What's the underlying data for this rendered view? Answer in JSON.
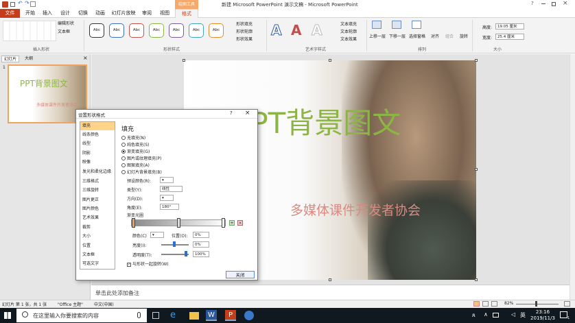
{
  "title_bar": {
    "title": "新建 Microsoft PowerPoint 演示文稿 - Microsoft PowerPoint",
    "context_group": "绘图工具",
    "help": "?"
  },
  "menu": {
    "file": "文件",
    "tabs": [
      "开始",
      "插入",
      "设计",
      "切换",
      "动画",
      "幻灯片放映",
      "审阅",
      "视图",
      "格式"
    ]
  },
  "ribbon": {
    "insert_shapes": {
      "edit_shape": "编辑形状",
      "text_box": "文本框",
      "label": "插入形状"
    },
    "shape_styles": {
      "sample": "Abc",
      "fill": "形状填充",
      "outline": "形状轮廓",
      "effects": "形状效果",
      "label": "形状样式"
    },
    "wordart": {
      "letter": "A",
      "text_fill": "文本填充",
      "text_outline": "文本轮廓",
      "text_effects": "文本效果",
      "label": "艺术字样式"
    },
    "arrange": {
      "forward": "上移一层",
      "backward": "下移一层",
      "pane": "选择窗格",
      "align": "对齐",
      "group": "组合",
      "rotate": "旋转",
      "label": "排列"
    },
    "size": {
      "height_label": "高度:",
      "height": "19.05 厘米",
      "width_label": "宽度:",
      "width": "25.4 厘米",
      "label": "大小"
    }
  },
  "left_pane": {
    "tab_slides": "幻灯片",
    "tab_outline": "大纲",
    "slide_number": "1",
    "thumb_title": "PPT背景图文",
    "thumb_subtitle": "多媒体课件开发者协会"
  },
  "slide": {
    "title": "PPT背景图文",
    "subtitle": "多媒体课件开发者协会"
  },
  "notes": {
    "placeholder": "单击此处添加备注"
  },
  "dialog": {
    "title": "设置形状格式",
    "help": "?",
    "close_x": "×",
    "nav": [
      "填充",
      "线条颜色",
      "线型",
      "阴影",
      "映像",
      "发光和柔化边缘",
      "三维格式",
      "三维旋转",
      "图片更正",
      "图片颜色",
      "艺术效果",
      "裁剪",
      "大小",
      "位置",
      "文本框",
      "可选文字"
    ],
    "section": "填充",
    "fill_options": [
      "无填充(N)",
      "纯色填充(S)",
      "渐变填充(G)",
      "图片或纹理填充(P)",
      "图案填充(A)",
      "幻灯片背景填充(B)"
    ],
    "selected_fill": 2,
    "preset_label": "预设颜色(R):",
    "type_label": "类型(Y):",
    "type_value": "线性",
    "direction_label": "方向(D):",
    "angle_label": "角度(E):",
    "angle_value": "180°",
    "stops_label": "渐变光圈",
    "color_label": "颜色(C)",
    "position_label": "位置(O):",
    "position_value": "0%",
    "brightness_label": "亮度(I):",
    "brightness_value": "0%",
    "transparency_label": "透明度(T):",
    "transparency_value": "100%",
    "rotate_check": "与形状一起旋转(W)",
    "close_button": "关闭"
  },
  "status": {
    "slide_info": "幻灯片 第 1 张，共 1 张",
    "theme": "\"Office 主题\"",
    "language": "中文(中国)",
    "zoom": "82%"
  },
  "taskbar": {
    "search_placeholder": "在这里输入你要搜索的内容",
    "ime": "英",
    "time": "23:16",
    "date": "2019/11/3",
    "notify_count": "1"
  },
  "colors": {
    "accent": "#c43e1c",
    "context": "#f6a96b",
    "title_green": "#8db545",
    "subtitle_red": "#d98a82"
  },
  "icons": [
    "save-icon",
    "undo-icon",
    "redo-icon",
    "search-icon",
    "microphone-icon",
    "word-icon",
    "powerpoint-icon",
    "notification-icon"
  ]
}
